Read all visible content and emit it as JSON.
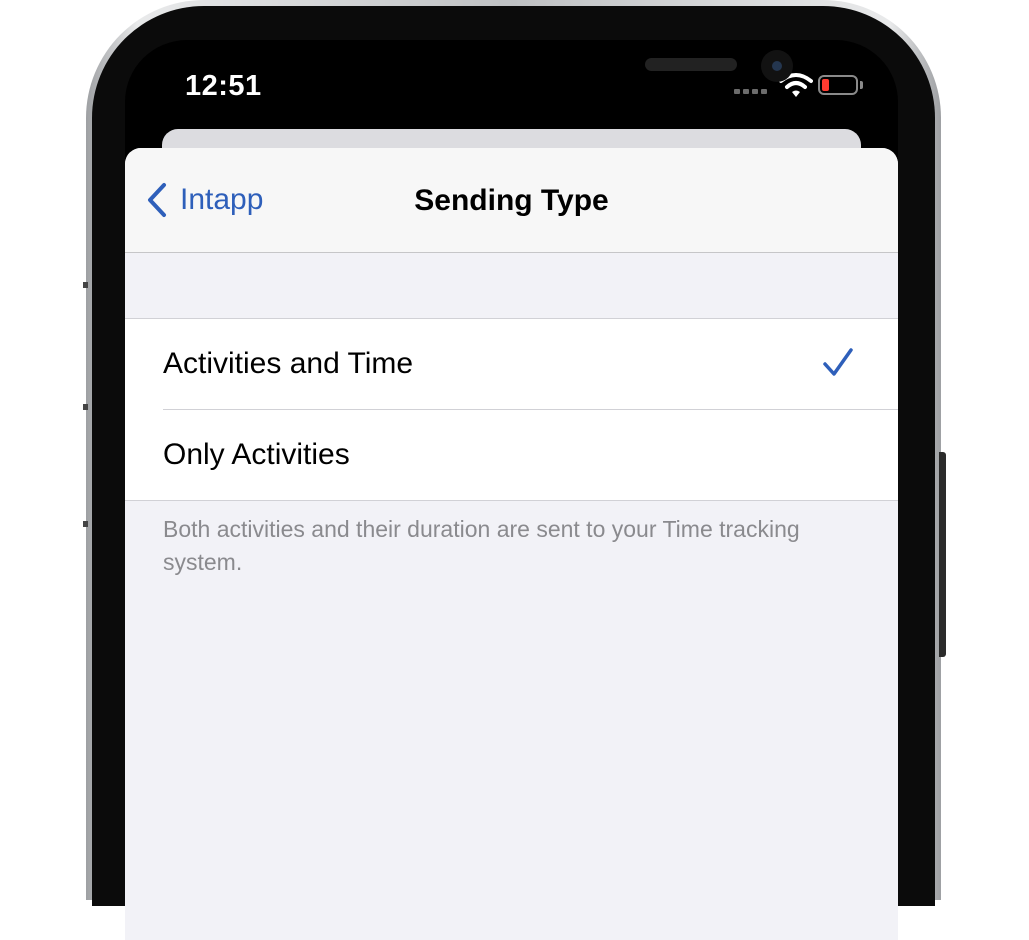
{
  "status_bar": {
    "time": "12:51",
    "battery_level": 0.15
  },
  "nav": {
    "back_label": "Intapp",
    "title": "Sending Type"
  },
  "options": [
    {
      "label": "Activities and Time",
      "selected": true
    },
    {
      "label": "Only Activities",
      "selected": false
    }
  ],
  "footer_note": "Both activities and their duration are sent to your Time tracking system.",
  "colors": {
    "accent": "#2e5fba",
    "background": "#f2f2f7",
    "battery_low": "#ff3b30"
  }
}
